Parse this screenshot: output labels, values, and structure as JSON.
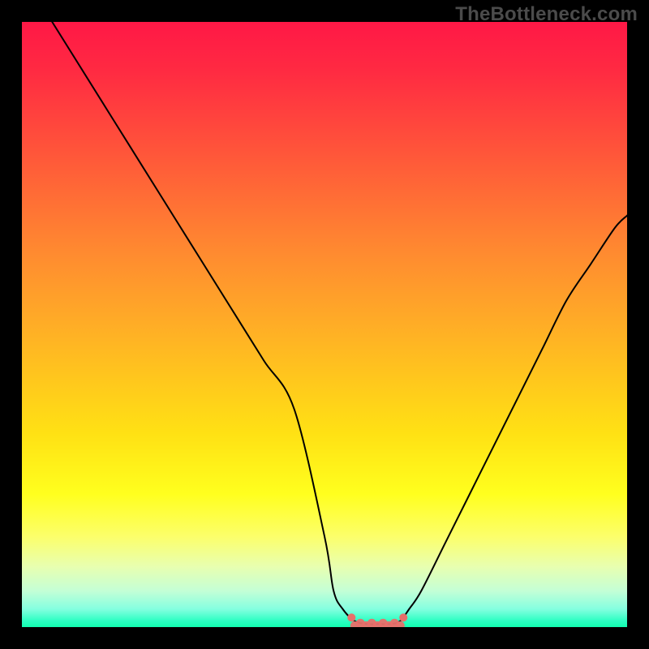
{
  "watermark": "TheBottleneck.com",
  "chart_data": {
    "type": "line",
    "title": "",
    "xlabel": "",
    "ylabel": "",
    "xlim": [
      0,
      100
    ],
    "ylim": [
      0,
      100
    ],
    "grid": false,
    "legend": false,
    "series": [
      {
        "name": "bottleneck-curve",
        "x": [
          5,
          10,
          15,
          20,
          25,
          30,
          35,
          40,
          45,
          50,
          51.5,
          53,
          55,
          57,
          59,
          61,
          62.5,
          64,
          66,
          70,
          74,
          78,
          82,
          86,
          90,
          94,
          98,
          100
        ],
        "y": [
          100,
          92,
          84,
          76,
          68,
          60,
          52,
          44,
          36,
          15,
          6,
          3,
          1,
          0.5,
          0.5,
          0.5,
          1,
          3,
          6,
          14,
          22,
          30,
          38,
          46,
          54,
          60,
          66,
          68
        ]
      }
    ],
    "annotations": [
      {
        "name": "optimal-zone-marker",
        "x_range": [
          55,
          62.5
        ],
        "y": 0.5
      }
    ],
    "background_gradient": {
      "top_color": "#ff1846",
      "mid_color": "#ffe114",
      "bottom_color": "#12ffb0"
    }
  }
}
